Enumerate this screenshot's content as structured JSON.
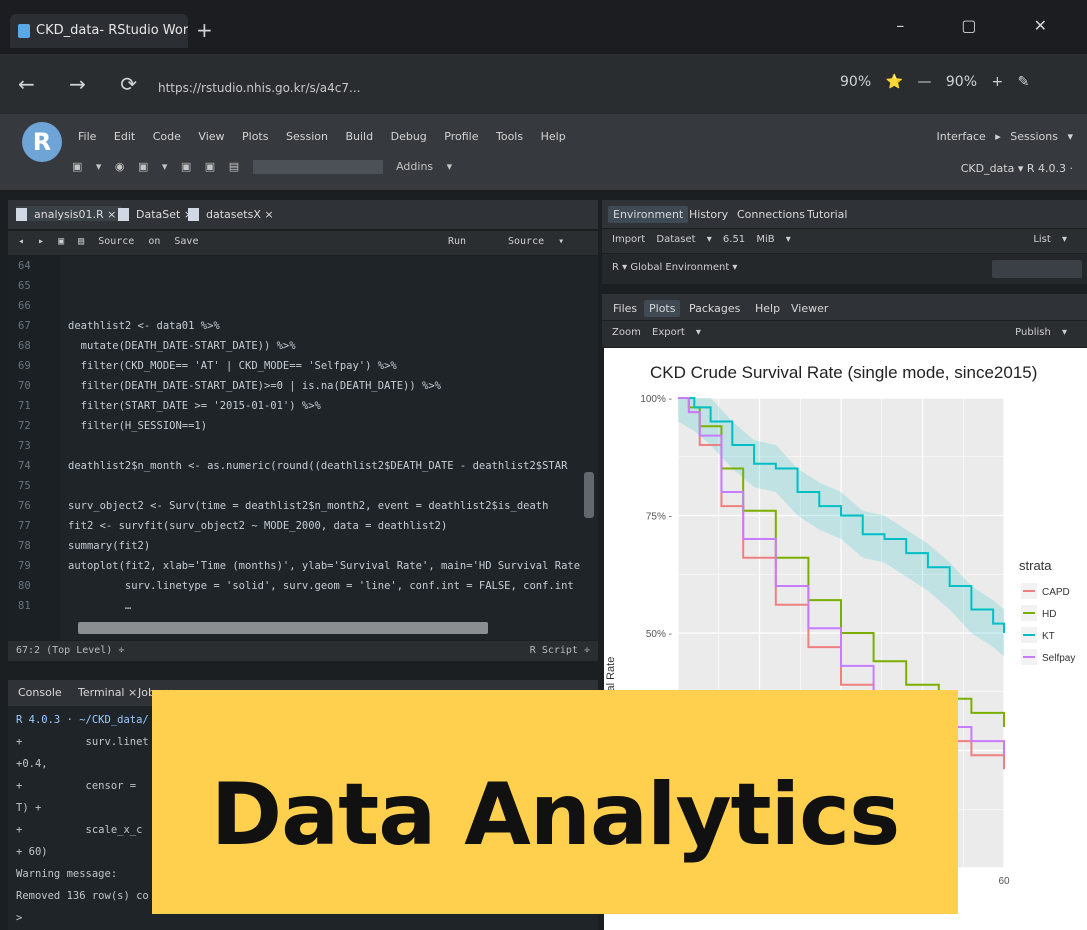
{
  "browser": {
    "tab_title": "CKD_data- RStudio Workbench ×",
    "new_tab": "+",
    "window_controls": "– ▢ ✕",
    "nav": "← → ⟳",
    "url": "https://rstudio.nhis.go.kr/s/a4c7...",
    "zoom": "90% ⭐ — 90% + ✎"
  },
  "rstudio": {
    "logo": "R",
    "menu": [
      "File",
      "Edit",
      "Code",
      "View",
      "Plots",
      "Session",
      "Build",
      "Debug",
      "Profile",
      "Tools",
      "Help"
    ],
    "toolbar_addins": "Addins ▾",
    "project": "CKD_data ▾",
    "version": "R 4.0.3 ·",
    "user_area": "Interface ▸  Sessions ▾"
  },
  "editor": {
    "tabs": [
      "analysis01.R ×",
      "DataSet ×",
      "datasetsX ×"
    ],
    "toolbar": [
      "Source on Save",
      "Run",
      "Source ▾"
    ],
    "lines": [
      {
        "n": "64",
        "code": ""
      },
      {
        "n": "65",
        "code": ""
      },
      {
        "n": "66",
        "code": ""
      },
      {
        "n": "67",
        "code": "deathlist2 <- data01 %>%"
      },
      {
        "n": "68",
        "code": "  mutate(DEATH_DATE-START_DATE)) %>%"
      },
      {
        "n": "69",
        "code": "  filter(CKD_MODE== 'AT' | CKD_MODE== 'Selfpay') %>%"
      },
      {
        "n": "70",
        "code": "  filter(DEATH_DATE-START_DATE)>=0 | is.na(DEATH_DATE)) %>%"
      },
      {
        "n": "71",
        "code": "  filter(START_DATE >= '2015-01-01') %>%"
      },
      {
        "n": "72",
        "code": "  filter(H_SESSION==1)"
      },
      {
        "n": "73",
        "code": ""
      },
      {
        "n": "74",
        "code": "deathlist2$n_month <- as.numeric(round((deathlist2$DEATH_DATE - deathlist2$STAR"
      },
      {
        "n": "75",
        "code": ""
      },
      {
        "n": "76",
        "code": "surv_object2 <- Surv(time = deathlist2$n_month2, event = deathlist2$is_death"
      },
      {
        "n": "77",
        "code": "fit2 <- survfit(surv_object2 ~ MODE_2000, data = deathlist2)"
      },
      {
        "n": "78",
        "code": "summary(fit2)"
      },
      {
        "n": "79",
        "code": "autoplot(fit2, xlab='Time (months)', ylab='Survival Rate', main='HD Survival Rate"
      },
      {
        "n": "80",
        "code": "         surv.linetype = 'solid', surv.geom = 'line', conf.int = FALSE, conf.int"
      },
      {
        "n": "81",
        "code": "         …"
      }
    ],
    "status_left": "67:2   (Top Level) ÷",
    "status_right": "R Script ÷"
  },
  "console": {
    "tabs": [
      "Console",
      "Terminal ×",
      "Jobs ×"
    ],
    "lines": [
      "R 4.0.3 · ~/CKD_data/",
      "+          surv.linet",
      "+0.4,",
      "+          censor =",
      "T) +",
      "+          scale_x_c",
      "+ 60)",
      "Warning message:",
      "Removed 136 row(s) co",
      ">"
    ]
  },
  "environment": {
    "tabs": [
      "Environment",
      "History",
      "Connections",
      "Tutorial"
    ],
    "toolbar": "Import Dataset ▾   6.51 MiB ▾",
    "scope": "R ▾   Global Environment ▾",
    "list": "List ▾"
  },
  "plots": {
    "tabs": [
      "Files",
      "Plots",
      "Packages",
      "Help",
      "Viewer"
    ],
    "toolbar": "Zoom   Export ▾",
    "publish": "Publish ▾"
  },
  "chart_data": {
    "type": "line",
    "title": "CKD Crude Survival Rate (single mode, since2015)",
    "ylabel": "Survival Rate",
    "xlabel": "",
    "ytick_labels": [
      "100% -",
      "75% -",
      "50% -"
    ],
    "xtick_labels": [
      "60"
    ],
    "xlim": [
      0,
      60
    ],
    "ylim": [
      0,
      1.0
    ],
    "legend_title": "strata",
    "legend_position": "right",
    "grid": true,
    "series": [
      {
        "name": "CAPD",
        "color": "#f08080",
        "x": [
          0,
          2,
          4,
          8,
          12,
          18,
          24,
          30,
          36,
          42,
          48,
          54,
          60
        ],
        "y": [
          1.0,
          0.97,
          0.9,
          0.77,
          0.66,
          0.56,
          0.47,
          0.39,
          0.34,
          0.29,
          0.27,
          0.24,
          0.21
        ]
      },
      {
        "name": "HD",
        "color": "#7cae00",
        "x": [
          0,
          2,
          4,
          8,
          12,
          18,
          24,
          30,
          36,
          42,
          48,
          54,
          60
        ],
        "y": [
          1.0,
          0.98,
          0.94,
          0.85,
          0.76,
          0.66,
          0.57,
          0.5,
          0.44,
          0.39,
          0.36,
          0.33,
          0.3
        ]
      },
      {
        "name": "KT",
        "color": "#00bfc4",
        "x": [
          0,
          3,
          6,
          10,
          14,
          18,
          22,
          26,
          30,
          34,
          38,
          42,
          46,
          50,
          54,
          58,
          60
        ],
        "y": [
          1.0,
          0.98,
          0.95,
          0.9,
          0.86,
          0.85,
          0.8,
          0.77,
          0.75,
          0.71,
          0.7,
          0.67,
          0.64,
          0.6,
          0.55,
          0.52,
          0.5
        ]
      },
      {
        "name": "Selfpay",
        "color": "#c77cff",
        "x": [
          0,
          2,
          4,
          8,
          12,
          18,
          24,
          30,
          36,
          42,
          48,
          54,
          60
        ],
        "y": [
          1.0,
          0.97,
          0.92,
          0.8,
          0.7,
          0.6,
          0.51,
          0.43,
          0.37,
          0.32,
          0.3,
          0.27,
          0.24
        ]
      }
    ]
  },
  "banner": {
    "text": "Data Analytics",
    "color": "#ffd04d"
  }
}
